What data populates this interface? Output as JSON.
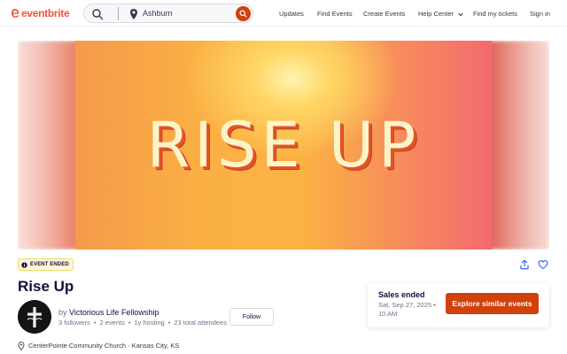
{
  "brand": {
    "logo_text": "eventbrite",
    "accent": "#d1410c",
    "logo_color": "#f05537"
  },
  "search": {
    "location": "Ashburn",
    "icon": "search-icon",
    "location_icon": "pin-icon"
  },
  "nav": {
    "updates": "Updates",
    "find_events": "Find Events",
    "create_events": "Create Events",
    "help_center": "Help Center",
    "find_tickets": "Find my tickets",
    "sign_in": "Sign in"
  },
  "hero": {
    "title_text": "RISE UP"
  },
  "event": {
    "status_badge": "EVENT ENDED",
    "title": "Rise Up",
    "organizer_prefix": "by",
    "organizer_name": "Victorious Life Fellowship",
    "followers": "3 followers",
    "events": "2 events",
    "hosting": "1y hosting",
    "attendees": "23 total attendees",
    "follow_label": "Follow",
    "location": "CenterPointe Community Church · Kansas City, KS"
  },
  "sales": {
    "title": "Sales ended",
    "date": "Sat, Sep 27, 2025 • 10 AM",
    "cta": "Explore similar events"
  }
}
